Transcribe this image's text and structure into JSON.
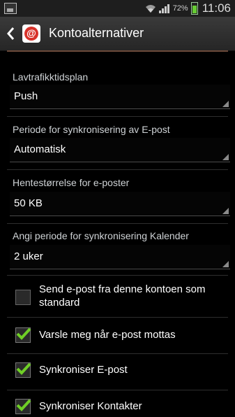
{
  "status_bar": {
    "battery_percent": "72%",
    "clock": "11:06",
    "icons": [
      "notification-icon",
      "wifi-icon",
      "signal-icon",
      "battery-icon"
    ]
  },
  "header": {
    "title": "Kontoalternativer",
    "icon": "email-app-icon",
    "icon_glyph": "@"
  },
  "settings": [
    {
      "label": "Lavtrafikktidsplan",
      "value": "Push"
    },
    {
      "label": "Periode for synkronisering av E-post",
      "value": "Automatisk"
    },
    {
      "label": "Hentestørrelse for e-poster",
      "value": "50 KB"
    },
    {
      "label": "Angi periode for synkronisering Kalender",
      "value": "2 uker"
    }
  ],
  "checkboxes": [
    {
      "line1": "Send e-post fra denne kontoen som",
      "line2": "standard",
      "checked": false
    },
    {
      "label": "Varsle meg når e-post mottas",
      "checked": true
    },
    {
      "label": "Synkroniser E-post",
      "checked": true
    },
    {
      "label": "Synkroniser Kontakter",
      "checked": true
    }
  ],
  "colors": {
    "check_green": "#6fcf26",
    "accent_line": "#6b4a3a"
  }
}
